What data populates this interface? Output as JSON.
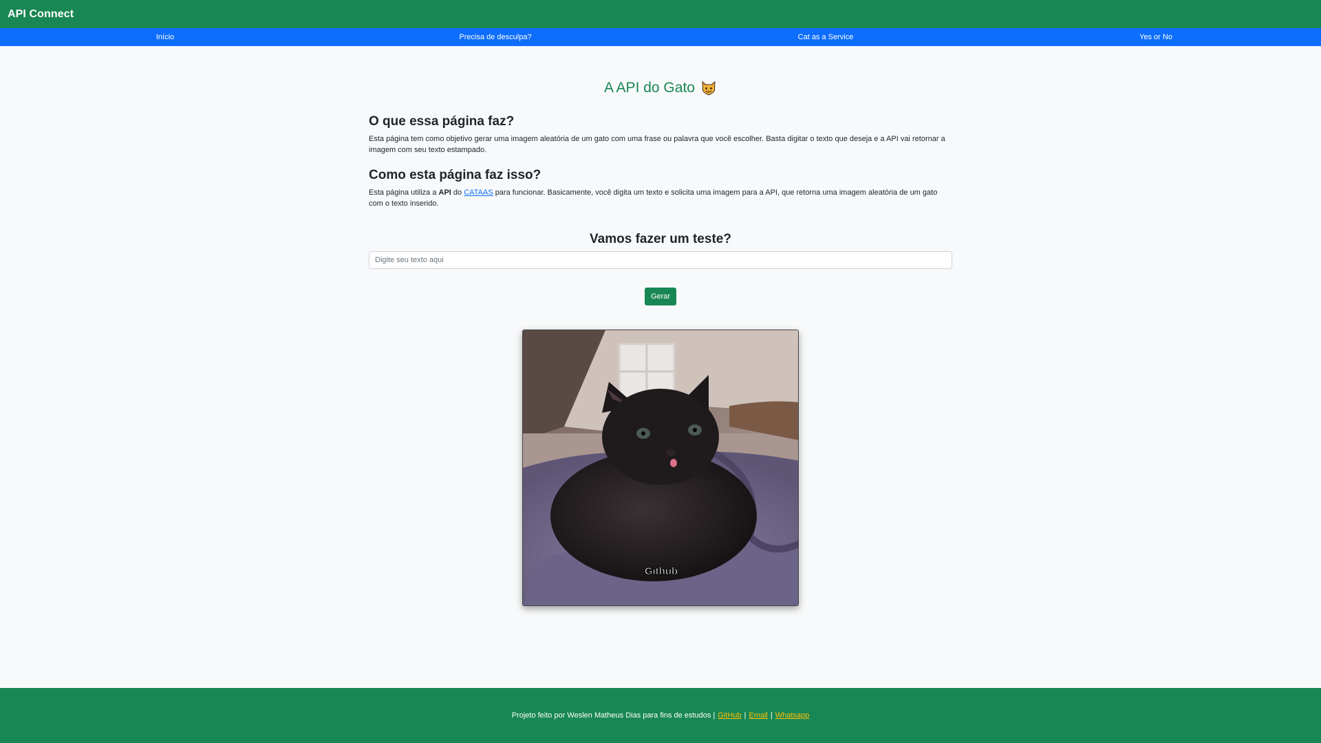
{
  "header": {
    "brand": "API Connect"
  },
  "nav": [
    {
      "label": "Início"
    },
    {
      "label": "Precisa de desculpa?"
    },
    {
      "label": "Cat as a Service"
    },
    {
      "label": "Yes or No"
    }
  ],
  "main": {
    "title": "A API do Gato",
    "title_icon": "smiling-cat-face-icon",
    "section1": {
      "heading": "O que essa página faz?",
      "text": "Esta página tem como objetivo gerar uma imagem aleatória de um gato com uma frase ou palavra que você escolher. Basta digitar o texto que deseja e a API vai retornar a imagem com seu texto estampado."
    },
    "section2": {
      "heading": "Como esta página faz isso?",
      "text_before": "Esta página utiliza a",
      "bold": "API",
      "text_mid": "do",
      "link": "CATAAS",
      "text_after": "para funcionar. Basicamente, você digita um texto e solicita uma imagem para a API, que retorna uma imagem aleatória de um gato com o texto inserido."
    },
    "test": {
      "heading": "Vamos fazer um teste?",
      "placeholder": "Digite seu texto aqui",
      "button": "Gerar"
    },
    "image": {
      "caption": "Github"
    }
  },
  "footer": {
    "text": "Projeto feito por Weslen Matheus Dias para fins de estudos |",
    "sep": "|",
    "links": [
      "GitHub",
      "Email",
      "Whatsapp"
    ]
  },
  "colors": {
    "green": "#198754",
    "blue": "#0d6efd",
    "link_yellow": "#ffc107",
    "background": "#f8f9fa"
  }
}
